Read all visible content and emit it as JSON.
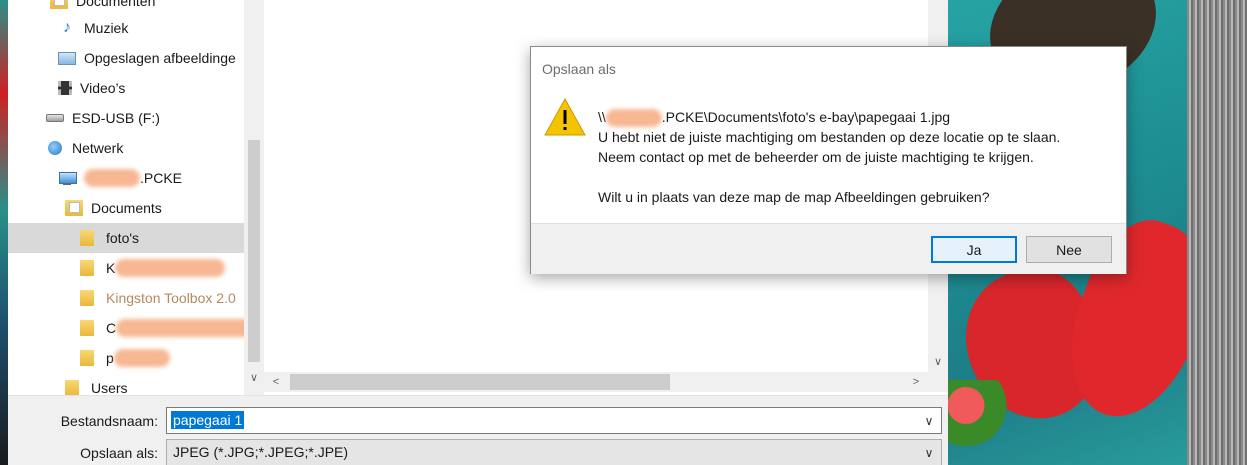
{
  "nav": {
    "items": [
      {
        "label": "Documenten",
        "icon": "documents-folder-icon"
      },
      {
        "label": "Muziek",
        "icon": "music-icon"
      },
      {
        "label": "Opgeslagen afbeeldinge",
        "icon": "saved-pictures-icon"
      },
      {
        "label": "Video’s",
        "icon": "video-icon"
      },
      {
        "label": "ESD-USB (F:)",
        "icon": "usb-drive-icon"
      },
      {
        "label": "Netwerk",
        "icon": "network-icon"
      },
      {
        "label": ".PCKE",
        "icon": "network-computer-icon"
      },
      {
        "label": "Documents",
        "icon": "documents-folder-icon"
      },
      {
        "label": "foto's",
        "icon": "folder-icon"
      },
      {
        "label": "K",
        "icon": "folder-icon"
      },
      {
        "label": "Kingston Toolbox 2.0",
        "icon": "folder-icon"
      },
      {
        "label": "C",
        "icon": "folder-icon"
      },
      {
        "label": "p",
        "icon": "folder-icon"
      },
      {
        "label": "Users",
        "icon": "folder-icon"
      }
    ]
  },
  "bottom": {
    "filename_label": "Bestandsnaam:",
    "filename_value": "papegaai 1",
    "filetype_label": "Opslaan als:",
    "filetype_value": "JPEG (*.JPG;*.JPEG;*.JPE)"
  },
  "dialog": {
    "title": "Opslaan als",
    "icon": "warning-icon",
    "path_prefix": "\\\\",
    "path_suffix": ".PCKE\\Documents\\foto's e-bay\\papegaai 1.jpg",
    "line2": "U hebt niet de juiste machtiging om bestanden op deze locatie op te slaan.",
    "line3": "Neem contact op met de beheerder om de juiste machtiging te krijgen.",
    "line4": "Wilt u in plaats van deze map de map Afbeeldingen gebruiken?",
    "yes_label": "Ja",
    "no_label": "Nee"
  },
  "colors": {
    "accent": "#0078d7",
    "warning": "#f5c400",
    "selected_row": "#d9d9d9",
    "redaction": "#f6b48d"
  }
}
